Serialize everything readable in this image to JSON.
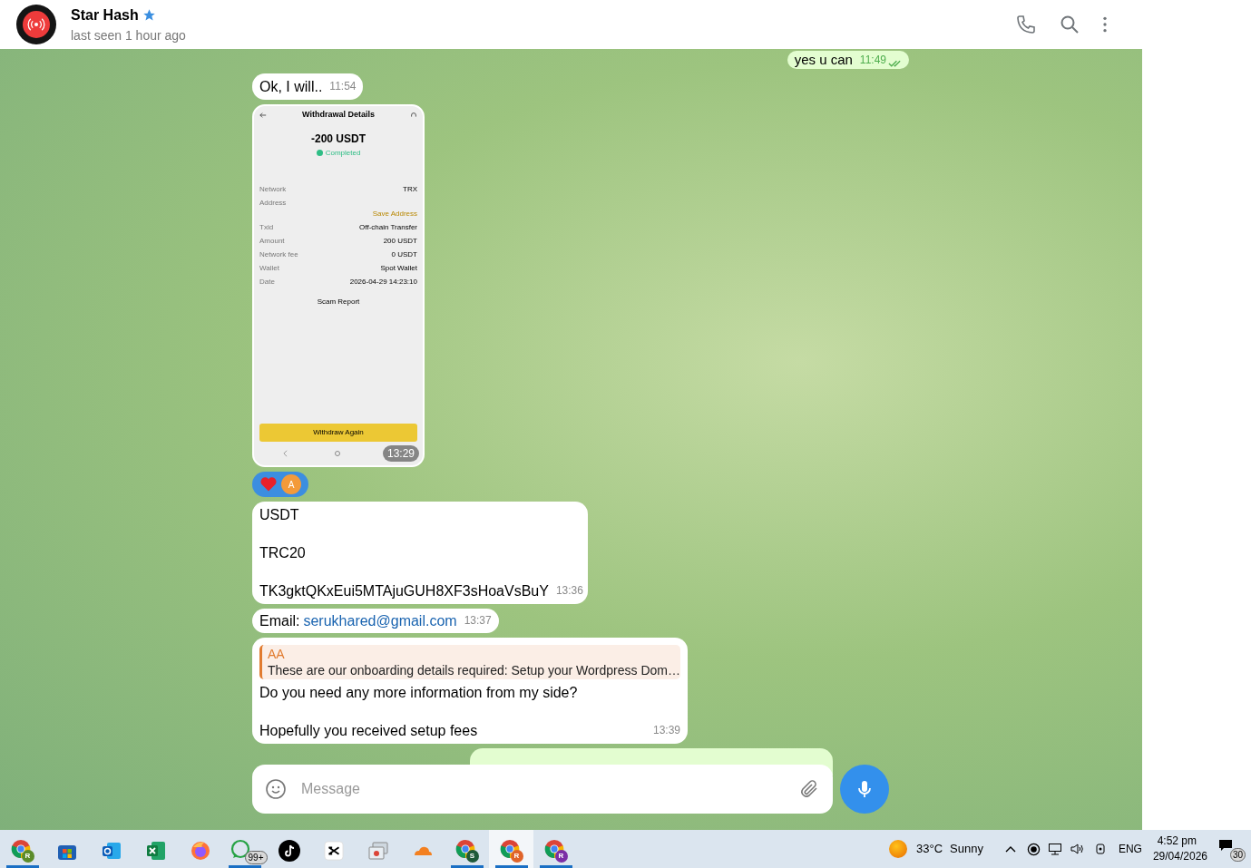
{
  "header": {
    "name": "Star Hash",
    "verified": true,
    "status": "last seen 1 hour ago"
  },
  "messages": [
    {
      "kind": "outgoing",
      "text": "yes u can",
      "time": "11:49",
      "read": true
    },
    {
      "kind": "text",
      "paragraphs": [
        "Ok, I will.."
      ],
      "time": "11:54"
    },
    {
      "kind": "screenshot",
      "time": "13:29",
      "title": "Withdrawal Details",
      "amount": "-200 USDT",
      "status": "Completed",
      "notice": "Save Address",
      "rows": [
        {
          "label": "Network",
          "value": "TRX"
        },
        {
          "label": "Address",
          "value": ""
        },
        {
          "label": "Txid",
          "value": "Off-chain Transfer"
        },
        {
          "label": "Amount",
          "value": "200 USDT"
        },
        {
          "label": "Network fee",
          "value": "0 USDT"
        },
        {
          "label": "Wallet",
          "value": "Spot Wallet"
        },
        {
          "label": "Date",
          "value": "2026-04-29 14:23:10"
        }
      ],
      "report": "Scam Report",
      "button": "Withdraw Again"
    },
    {
      "kind": "reactions",
      "avatar": "A"
    },
    {
      "kind": "text",
      "paragraphs": [
        "USDT",
        "TRC20",
        "TK3gktQKxEui5MTAjuGUH8XF3sHoaVsBuY"
      ],
      "time": "13:36"
    },
    {
      "kind": "email",
      "label": "Email:",
      "link": "serukhared@gmail.com",
      "time": "13:37"
    },
    {
      "kind": "reply",
      "sender": "AA",
      "quote": "These are our onboarding details required: Setup your Wordpress Dom…",
      "paragraphs": [
        "Do you need any more information from my side?",
        "Hopefully you received setup fees"
      ],
      "time": "13:39"
    },
    {
      "kind": "outgoing-cut"
    }
  ],
  "composer": {
    "placeholder": "Message"
  },
  "taskbar": {
    "apps": [
      {
        "kind": "chrome",
        "badge": "R",
        "color": "#5b8c2a",
        "running": true,
        "selected": false
      },
      {
        "kind": "store",
        "running": false,
        "selected": false
      },
      {
        "kind": "outlook",
        "running": false,
        "selected": false
      },
      {
        "kind": "excel",
        "running": false,
        "selected": false
      },
      {
        "kind": "firefox",
        "running": false,
        "selected": false
      },
      {
        "kind": "whatsapp",
        "count": "99+",
        "running": true,
        "selected": false
      },
      {
        "kind": "tiktok",
        "running": false,
        "selected": false
      },
      {
        "kind": "capcut",
        "running": false,
        "selected": false
      },
      {
        "kind": "windows",
        "running": false,
        "selected": false
      },
      {
        "kind": "cloud",
        "running": false,
        "selected": false
      },
      {
        "kind": "chrome",
        "badge": "S",
        "color": "#1f5a3a",
        "running": true,
        "selected": false
      },
      {
        "kind": "chrome",
        "badge": "R",
        "color": "#e0642a",
        "running": true,
        "selected": true
      },
      {
        "kind": "chrome",
        "badge": "R",
        "color": "#7b2fa6",
        "running": true,
        "selected": false
      }
    ],
    "temperature": "33°C",
    "weather": "Sunny",
    "language": "ENG",
    "time": "4:52 pm",
    "date": "29/04/2026",
    "notifications": "30"
  }
}
